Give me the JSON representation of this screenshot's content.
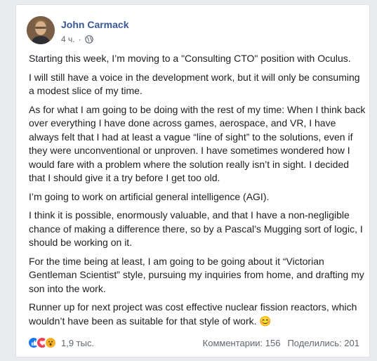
{
  "post": {
    "author": "John Carmack",
    "time": "4 ч.",
    "separator": "·",
    "privacy_icon": "globe-icon",
    "paragraphs": [
      "Starting this week, I’m moving to a \"Consulting CTO\" position with Oculus.",
      "I will still have a voice in the development work, but it will only be consuming a modest slice of my time.",
      "As for what I am going to be doing with the rest of my time: When I think back over everything I have done across games, aerospace, and VR, I have always felt that I had at least a vague “line of sight” to the solutions, even if they were unconventional or unproven. I have sometimes wondered how I would fare with a problem where the solution really isn’t in sight. I decided that I should give it a try before I get too old.",
      "I’m going to work on artificial general intelligence (AGI).",
      "I think it is possible, enormously valuable, and that I have a non-negligible chance of making a difference there, so by a Pascal’s Mugging sort of logic, I should be working on it.",
      "For the time being at least, I am going to be going about it “Victorian Gentleman Scientist” style, pursuing my inquiries from home, and drafting my son into the work.",
      "Runner up for next project was cost effective nuclear fission reactors, which wouldn’t have been as suitable for that style of work. 😊"
    ]
  },
  "footer": {
    "reaction_icons": [
      "like-icon",
      "love-icon",
      "wow-icon"
    ],
    "reaction_count": "1,9 тыс.",
    "comments": "Комментарии: 156",
    "shares": "Поделились: 201"
  },
  "colors": {
    "author": "#385898",
    "text": "#1c1e21",
    "meta": "#616770",
    "background": "#e9ebee"
  }
}
